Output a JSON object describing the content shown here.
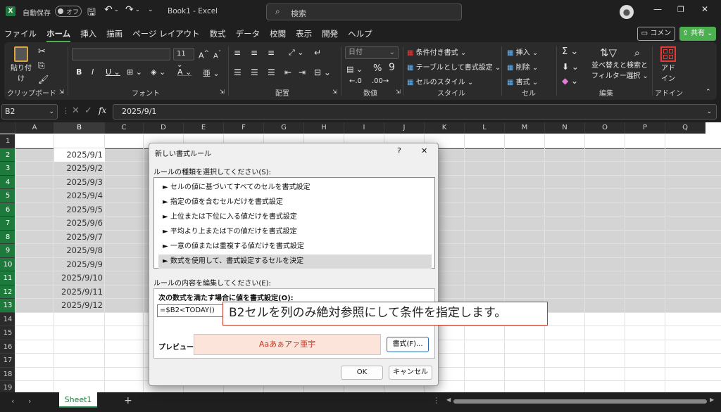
{
  "titlebar": {
    "autosave_label": "自動保存",
    "autosave_state": "オフ",
    "title": "Book1 - Excel",
    "search_placeholder": "検索"
  },
  "menubar": {
    "tabs": [
      "ファイル",
      "ホーム",
      "挿入",
      "描画",
      "ページ レイアウト",
      "数式",
      "データ",
      "校閲",
      "表示",
      "開発",
      "ヘルプ"
    ],
    "comment_label": "コメント",
    "share_label": "共有"
  },
  "ribbon": {
    "clipboard": {
      "paste": "貼り付け",
      "label": "クリップボード"
    },
    "font": {
      "size": "11",
      "label": "フォント"
    },
    "alignment": {
      "label": "配置"
    },
    "number": {
      "format": "日付",
      "label": "数値"
    },
    "styles": {
      "conditional": "条件付き書式",
      "table": "テーブルとして書式設定",
      "cell_styles": "セルのスタイル",
      "label": "スタイル"
    },
    "cells": {
      "insert": "挿入",
      "delete": "削除",
      "format": "書式",
      "label": "セル"
    },
    "editing": {
      "sort_1": "並べ替えと",
      "sort_2": "フィルター",
      "find_1": "検索と",
      "find_2": "選択",
      "label": "編集"
    },
    "addins": {
      "addin_1": "アド",
      "addin_2": "イン",
      "label": "アドイン"
    }
  },
  "formula_bar": {
    "name_box": "B2",
    "fx": "fx",
    "formula": "2025/9/1"
  },
  "grid": {
    "columns": [
      "A",
      "B",
      "C",
      "D",
      "E",
      "F",
      "G",
      "H",
      "I",
      "J",
      "K",
      "L",
      "M",
      "N",
      "O",
      "P",
      "Q"
    ],
    "rows": [
      "1",
      "2",
      "3",
      "4",
      "5",
      "6",
      "7",
      "8",
      "9",
      "10",
      "11",
      "12",
      "13",
      "14",
      "15",
      "16",
      "17",
      "18",
      "19"
    ],
    "b_values": [
      "2025/9/1",
      "2025/9/2",
      "2025/9/3",
      "2025/9/4",
      "2025/9/5",
      "2025/9/6",
      "2025/9/7",
      "2025/9/8",
      "2025/9/9",
      "2025/9/10",
      "2025/9/11",
      "2025/9/12"
    ]
  },
  "dialog": {
    "title": "新しい書式ルール",
    "help": "?",
    "close": "✕",
    "rule_type_label": "ルールの種類を選択してください(S):",
    "rules": [
      "► セルの値に基づいてすべてのセルを書式設定",
      "► 指定の値を含むセルだけを書式設定",
      "► 上位または下位に入る値だけを書式設定",
      "► 平均より上または下の値だけを書式設定",
      "► 一意の値または重複する値だけを書式設定",
      "► 数式を使用して、書式設定するセルを決定"
    ],
    "edit_label": "ルールの内容を編集してください(E):",
    "formula_caption": "次の数式を満たす場合に値を書式設定(O):",
    "formula_value": "=$B2<TODAY()",
    "preview_label": "プレビュー:",
    "preview_text": "Aaあぁアァ亜宇",
    "format_button": "書式(F)...",
    "ok": "OK",
    "cancel": "キャンセル"
  },
  "annotation": "B2セルを列のみ絶対参照にして条件を指定します。",
  "statusbar": {
    "sheet": "Sheet1",
    "add": "+"
  },
  "colors": {
    "accent": "#1e7a3c",
    "preview_bg": "#fde4da",
    "preview_text": "#c0392b",
    "annotation_border": "#c0392b"
  }
}
